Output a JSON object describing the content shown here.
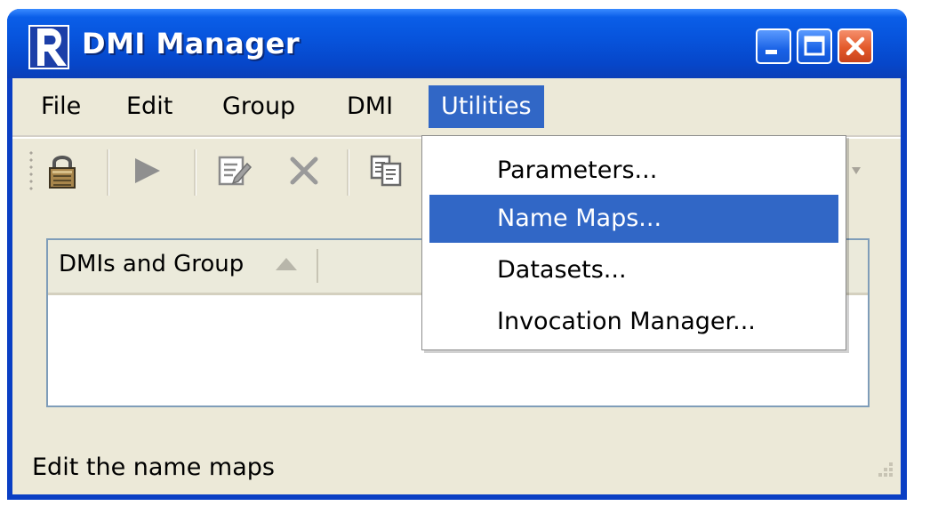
{
  "window": {
    "title": "DMI Manager",
    "colors": {
      "titlebar": "#0753db",
      "menu_highlight": "#3167c6",
      "face": "#ece9d8"
    }
  },
  "menubar": {
    "items": [
      {
        "label": "File"
      },
      {
        "label": "Edit"
      },
      {
        "label": "Group"
      },
      {
        "label": "DMI"
      },
      {
        "label": "Utilities"
      }
    ],
    "open_menu": "Utilities"
  },
  "toolbar": {
    "buttons": [
      {
        "icon": "lock-icon"
      },
      {
        "icon": "play-icon"
      },
      {
        "icon": "edit-icon"
      },
      {
        "icon": "delete-icon"
      },
      {
        "icon": "copy-icon"
      }
    ]
  },
  "utilities_menu": {
    "items": [
      {
        "label": "Parameters..."
      },
      {
        "label": "Name Maps..."
      },
      {
        "label": "Datasets..."
      },
      {
        "label": "Invocation Manager..."
      }
    ],
    "highlighted": "Name Maps..."
  },
  "list": {
    "column_header": "DMIs and Group",
    "sort": "ascending"
  },
  "statusbar": {
    "text": "Edit the name maps"
  }
}
